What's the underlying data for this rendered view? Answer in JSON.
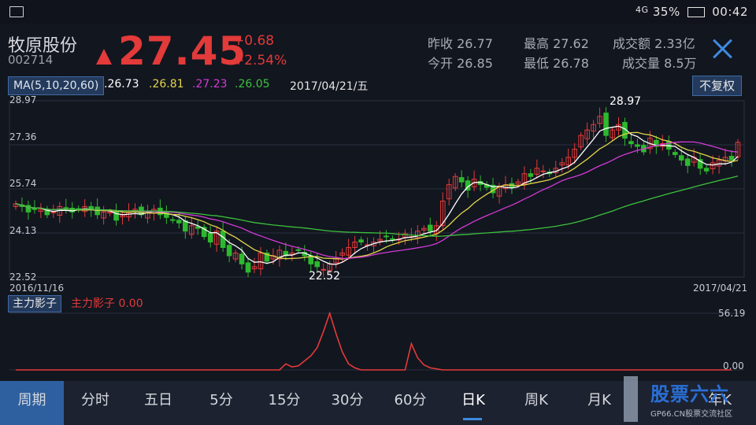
{
  "status": {
    "battery": "35%",
    "time": "00:42",
    "network": "4G"
  },
  "stock": {
    "name": "牧原股份",
    "code": "002714",
    "price": "27.45",
    "change": "+0.68",
    "change_pct": "+2.54%"
  },
  "stats": {
    "prev_close_label": "昨收",
    "prev_close": "26.77",
    "open_label": "今开",
    "open": "26.85",
    "high_label": "最高",
    "high": "27.62",
    "low_label": "最低",
    "low": "26.78",
    "turnover_label": "成交额",
    "turnover": "2.33亿",
    "volume_label": "成交量",
    "volume": "8.5万"
  },
  "ma_bar": {
    "label": "MA(5,10,20,60)",
    "ma5": ".26.73",
    "ma10": ".26.81",
    "ma20": ".27.23",
    "ma60": ".26.05",
    "date": "2017/04/21/五",
    "adjust_label": "不复权"
  },
  "indicator": {
    "tag": "主力影子",
    "label": "主力影子  0.00"
  },
  "periods": [
    "周期",
    "分时",
    "五日",
    "5分",
    "15分",
    "30分",
    "60分",
    "日K",
    "周K",
    "月K",
    "年K"
  ],
  "watermark": {
    "text": "股票六六",
    "sub": "GP66.CN股票交流社区"
  },
  "colors": {
    "up": "#e33a3a",
    "down": "#2eb82e",
    "ma5": "#ffffff",
    "ma10": "#e3d54a",
    "ma20": "#d23ad6",
    "ma60": "#3cc23c",
    "accent": "#3d8ae0"
  },
  "chart_data": [
    {
      "type": "candlestick",
      "title": "",
      "x_range": [
        "2016/11/16",
        "2017/04/21"
      ],
      "y_ticks": [
        "28.97",
        "27.36",
        "25.74",
        "24.13",
        "22.52"
      ],
      "ylim": [
        22.52,
        28.97
      ],
      "annotations": [
        {
          "text": "28.97",
          "kind": "max"
        },
        {
          "text": "22.52",
          "kind": "min"
        }
      ],
      "candles_close": [
        25.2,
        25.1,
        24.9,
        25.0,
        25.0,
        24.8,
        24.9,
        25.1,
        25.0,
        24.9,
        25.0,
        25.1,
        25.0,
        24.8,
        24.9,
        24.9,
        24.6,
        24.8,
        24.9,
        25.0,
        24.8,
        24.9,
        25.0,
        24.8,
        24.7,
        24.6,
        24.5,
        24.2,
        24.4,
        24.3,
        24.0,
        23.8,
        24.2,
        23.6,
        23.3,
        23.4,
        23.0,
        22.7,
        22.9,
        23.4,
        23.1,
        23.3,
        23.5,
        23.3,
        23.4,
        23.5,
        23.3,
        23.0,
        22.9,
        22.8,
        23.0,
        23.2,
        23.4,
        23.6,
        23.8,
        23.8,
        23.7,
        23.8,
        23.9,
        24.0,
        23.9,
        23.9,
        24.1,
        24.0,
        24.2,
        24.3,
        24.2,
        24.4,
        25.3,
        25.9,
        26.2,
        26.0,
        25.7,
        26.1,
        25.9,
        25.8,
        25.6,
        25.8,
        25.9,
        25.8,
        26.0,
        26.3,
        26.2,
        26.5,
        26.4,
        26.3,
        26.5,
        26.7,
        26.9,
        27.2,
        27.7,
        27.9,
        28.1,
        28.4,
        27.7,
        27.9,
        28.1,
        27.6,
        27.4,
        27.3,
        27.1,
        27.6,
        27.3,
        27.4,
        27.2,
        27.0,
        26.8,
        26.6,
        26.9,
        26.5,
        26.4,
        26.7,
        26.8,
        26.9,
        26.8,
        27.45
      ],
      "series": [
        {
          "name": "MA5",
          "last": 26.73
        },
        {
          "name": "MA10",
          "last": 26.81
        },
        {
          "name": "MA20",
          "last": 27.23
        },
        {
          "name": "MA60",
          "last": 26.05
        }
      ]
    },
    {
      "type": "line",
      "title": "",
      "y_ticks": [
        "56.19",
        "0.00"
      ],
      "ylim": [
        0,
        56.19
      ],
      "series": [
        {
          "name": "主力影子",
          "values": [
            0,
            0,
            0,
            0,
            0,
            0,
            0,
            0,
            0,
            0,
            0,
            0,
            0,
            0,
            0,
            0,
            0,
            0,
            0,
            0,
            0,
            0,
            0,
            0,
            0,
            0,
            0,
            0,
            0,
            0,
            0,
            0,
            0,
            0,
            0,
            0,
            0,
            0,
            0,
            0,
            0,
            0,
            0,
            6,
            3,
            4,
            9,
            14,
            22,
            38,
            56.19,
            36,
            18,
            6,
            2,
            0,
            0,
            0,
            0,
            0,
            0,
            0,
            0,
            26,
            12,
            5,
            2,
            1,
            0,
            0,
            0,
            0,
            0,
            0,
            0,
            0,
            0,
            0,
            0,
            0,
            0,
            0,
            0,
            0,
            0,
            0,
            0,
            0,
            0,
            0,
            0,
            0,
            0,
            0,
            0,
            0,
            0,
            0,
            0,
            0,
            0,
            0,
            0,
            0,
            0,
            0,
            0,
            0,
            0,
            0,
            0,
            0,
            0,
            0,
            0
          ]
        }
      ]
    }
  ]
}
